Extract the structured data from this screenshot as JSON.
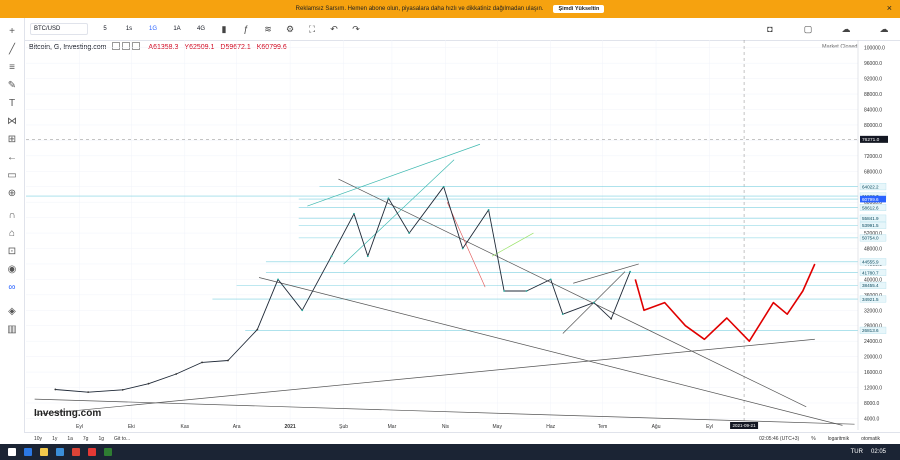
{
  "banner": {
    "text": "Reklamsız Sarsım. Hemen abone olun, piyasalara daha hızlı ve dikkatiniz dağılmadan ulaşın.",
    "button": "Şimdi Yükseltin"
  },
  "toolbar": {
    "symbol": "BTC/USD",
    "timeframes": [
      "5",
      "1s",
      "1G",
      "1A",
      "4G"
    ],
    "active_timeframe": "1G"
  },
  "legend": {
    "title": "Bitcoin, G, Investing.com",
    "open": "A61358.3",
    "high": "Y62509.1",
    "low": "D59672.1",
    "close": "K60799.6"
  },
  "market_status": "Market Closed",
  "logo": "Investing.com",
  "bottombar": {
    "ranges": [
      "10y",
      "1y",
      "1a",
      "7g",
      "1g",
      "Git to..."
    ],
    "time": "02:05:46 (UTC+3)",
    "percent": "%",
    "log": "logaritmik",
    "auto": "otomatik"
  },
  "taskbar": {
    "lang": "TUR",
    "time": "02:05"
  },
  "colors": {
    "up": "#26a69a",
    "down": "#c0392b",
    "projection": "#e00000",
    "hline": "#7ed0e0"
  },
  "chart_data": {
    "type": "line",
    "title": "Bitcoin, G, Investing.com",
    "x_ticks": [
      "Eyl",
      "Eki",
      "Kas",
      "Ara",
      "2021",
      "Şub",
      "Mar",
      "Nis",
      "May",
      "Haz",
      "Tem",
      "Ağu",
      "Eyl"
    ],
    "y_ticks": [
      4000,
      8000,
      12000,
      16000,
      20000,
      24000,
      28000,
      32000,
      36000,
      40000,
      44000,
      48000,
      52000,
      56000,
      60000,
      64000,
      68000,
      72000,
      76000,
      80000,
      84000,
      88000,
      92000,
      96000,
      100000
    ],
    "ylim": [
      1000,
      102000
    ],
    "cursor_date": "2021-09-21",
    "cursor_price": "76271.0",
    "price_levels": [
      "64022.2",
      "61580.7",
      "60799.6",
      "58612.6",
      "55841.9",
      "53991.5",
      "50754.0",
      "44555.9",
      "41780.7",
      "38455.4",
      "34921.5",
      "26813.6"
    ],
    "series": [
      {
        "name": "BTC/USD",
        "points": [
          [
            "2020-09-01",
            11500
          ],
          [
            "2020-09-20",
            10800
          ],
          [
            "2020-10-10",
            11400
          ],
          [
            "2020-10-25",
            13000
          ],
          [
            "2020-11-10",
            15500
          ],
          [
            "2020-11-25",
            18500
          ],
          [
            "2020-12-10",
            19000
          ],
          [
            "2020-12-27",
            27000
          ],
          [
            "2021-01-08",
            40000
          ],
          [
            "2021-01-22",
            32000
          ],
          [
            "2021-02-08",
            46000
          ],
          [
            "2021-02-21",
            57000
          ],
          [
            "2021-03-01",
            46000
          ],
          [
            "2021-03-13",
            61000
          ],
          [
            "2021-03-25",
            52000
          ],
          [
            "2021-04-14",
            64000
          ],
          [
            "2021-04-25",
            48000
          ],
          [
            "2021-05-10",
            58000
          ],
          [
            "2021-05-19",
            37000
          ],
          [
            "2021-06-01",
            37000
          ],
          [
            "2021-06-15",
            40000
          ],
          [
            "2021-06-22",
            31000
          ],
          [
            "2021-07-10",
            34000
          ],
          [
            "2021-07-20",
            29800
          ],
          [
            "2021-07-31",
            42000
          ]
        ]
      },
      {
        "name": "Projection",
        "points": [
          [
            "2021-08-03",
            40000
          ],
          [
            "2021-08-08",
            32000
          ],
          [
            "2021-08-20",
            34000
          ],
          [
            "2021-09-01",
            28000
          ],
          [
            "2021-09-12",
            24500
          ],
          [
            "2021-09-25",
            30000
          ],
          [
            "2021-10-08",
            24000
          ],
          [
            "2021-10-22",
            34000
          ],
          [
            "2021-10-30",
            31000
          ],
          [
            "2021-11-08",
            37000
          ],
          [
            "2021-11-15",
            44000
          ]
        ]
      }
    ]
  }
}
